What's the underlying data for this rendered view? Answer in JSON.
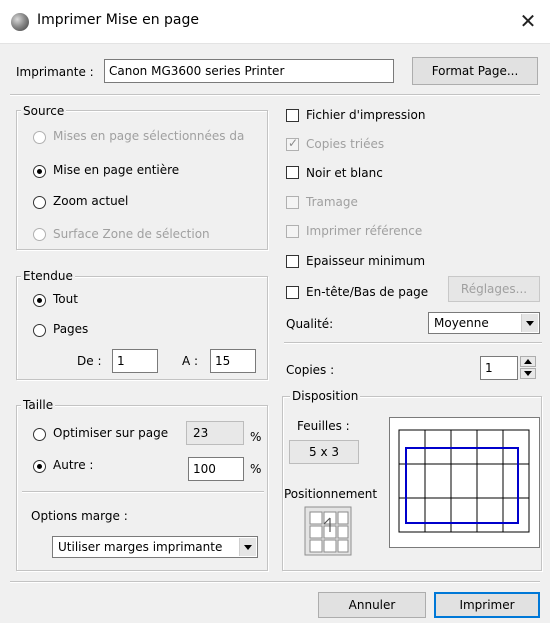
{
  "window": {
    "title": "Imprimer Mise en page",
    "close_glyph": "✕",
    "icon": "app-sphere-icon"
  },
  "printer": {
    "label": "Imprimante :",
    "value": "Canon MG3600 series Printer",
    "format_button": "Format Page..."
  },
  "source": {
    "legend": "Source",
    "options": [
      {
        "label": "Mises en page sélectionnées da",
        "checked": false,
        "enabled": false
      },
      {
        "label": "Mise en page entière",
        "checked": true,
        "enabled": true
      },
      {
        "label": "Zoom actuel",
        "checked": false,
        "enabled": true
      },
      {
        "label": "Surface Zone de sélection",
        "checked": false,
        "enabled": false
      }
    ]
  },
  "range": {
    "legend": "Etendue",
    "all_label": "Tout",
    "all_checked": true,
    "pages_label": "Pages",
    "pages_checked": false,
    "from_label": "De :",
    "from_value": "1",
    "to_label": "A :",
    "to_value": "15"
  },
  "size": {
    "legend": "Taille",
    "fit_label": "Optimiser sur page",
    "fit_value": "23",
    "fit_unit": "%",
    "fit_checked": false,
    "other_label": "Autre :",
    "other_value": "100",
    "other_unit": "%",
    "other_checked": true,
    "margin_label": "Options marge :",
    "margin_value": "Utiliser marges imprimante"
  },
  "options": {
    "print_to_file": {
      "label": "Fichier d'impression",
      "checked": false,
      "enabled": true
    },
    "collate": {
      "label": "Copies triées",
      "checked": true,
      "enabled": false
    },
    "black_white": {
      "label": "Noir et blanc",
      "checked": false,
      "enabled": true
    },
    "hatching": {
      "label": "Tramage",
      "checked": false,
      "enabled": false
    },
    "print_reference": {
      "label": "Imprimer référence",
      "checked": false,
      "enabled": false
    },
    "min_thickness": {
      "label": "Epaisseur minimum",
      "checked": false,
      "enabled": true
    },
    "header_footer": {
      "label": "En-tête/Bas de page",
      "checked": false,
      "enabled": true
    },
    "settings_button": "Réglages...",
    "quality_label": "Qualité:",
    "quality_value": "Moyenne"
  },
  "copies": {
    "label": "Copies :",
    "value": "1"
  },
  "layout": {
    "legend": "Disposition",
    "sheets_label": "Feuilles :",
    "sheets_value": "5 x 3",
    "positioning_label": "Positionnement",
    "grid_cols": 5,
    "grid_rows": 3,
    "frame_color": "#0000cc"
  },
  "footer": {
    "cancel": "Annuler",
    "print": "Imprimer"
  },
  "colors": {
    "accent": "#0078d7",
    "disabled_text": "#a0a0a0",
    "background": "#f0f0f0"
  }
}
